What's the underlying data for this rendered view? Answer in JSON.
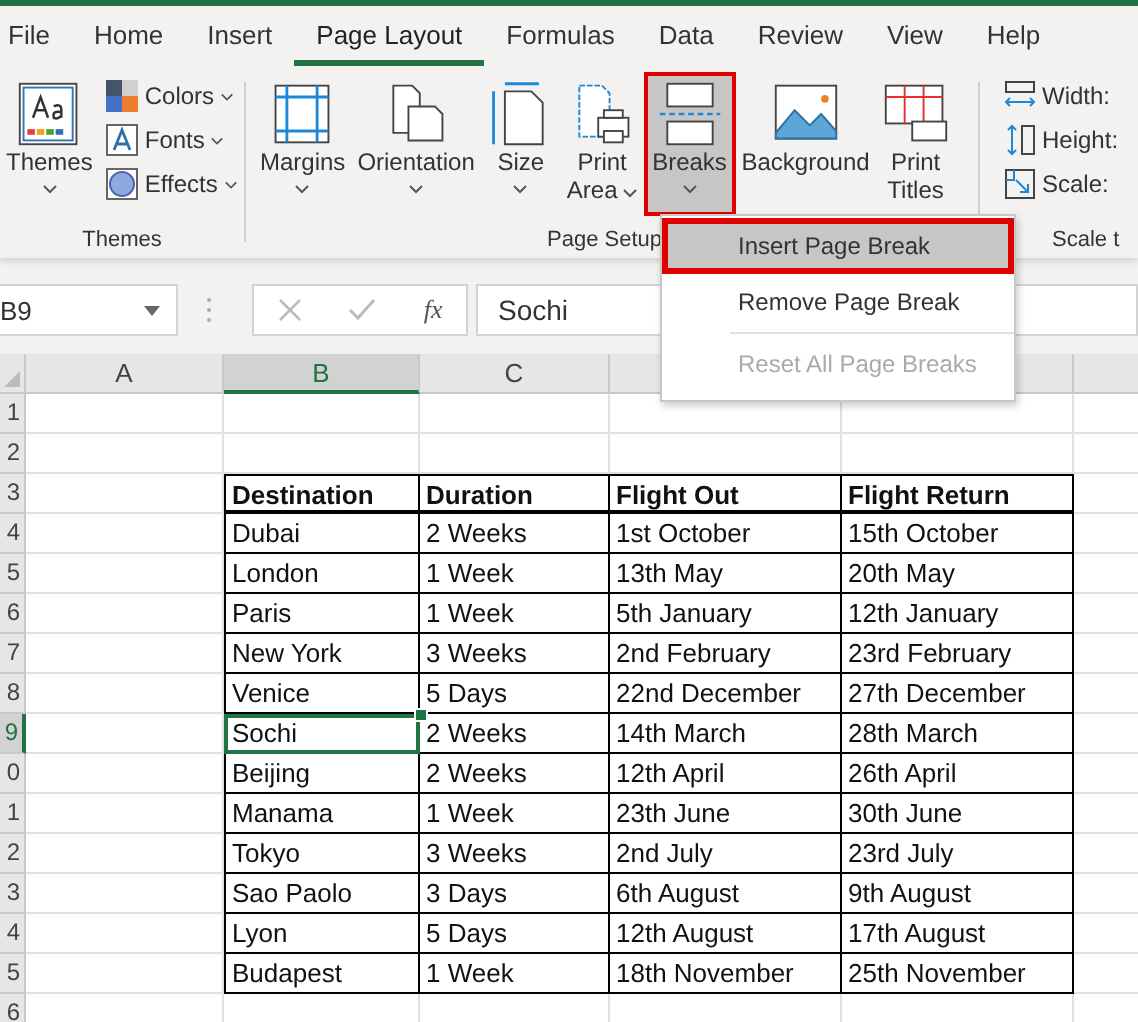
{
  "tabs": [
    {
      "label": "File",
      "selected": false
    },
    {
      "label": "Home",
      "selected": false
    },
    {
      "label": "Insert",
      "selected": false
    },
    {
      "label": "Page Layout",
      "selected": true
    },
    {
      "label": "Formulas",
      "selected": false
    },
    {
      "label": "Data",
      "selected": false
    },
    {
      "label": "Review",
      "selected": false
    },
    {
      "label": "View",
      "selected": false
    },
    {
      "label": "Help",
      "selected": false
    }
  ],
  "ribbon": {
    "groups": [
      {
        "label": "Themes",
        "buttons": [
          {
            "kind": "themes",
            "label": "Themes",
            "caret": true,
            "highlighted": false
          }
        ],
        "small_buttons": [
          {
            "kind": "colors",
            "label": "Colors"
          },
          {
            "kind": "fonts",
            "label": "Fonts"
          },
          {
            "kind": "effects",
            "label": "Effects"
          }
        ]
      },
      {
        "label": "Page Setup",
        "buttons": [
          {
            "kind": "margins",
            "label": "Margins",
            "caret": true,
            "highlighted": false
          },
          {
            "kind": "orientation",
            "label": "Orientation",
            "caret": true,
            "highlighted": false
          },
          {
            "kind": "size",
            "label": "Size",
            "caret": true,
            "highlighted": false
          },
          {
            "kind": "print-area",
            "label": "Print",
            "label_2": "Area",
            "caret": true,
            "highlighted": false
          },
          {
            "kind": "breaks",
            "label": "Breaks",
            "caret": true,
            "highlighted": true
          },
          {
            "kind": "background",
            "label": "Background",
            "caret": false,
            "highlighted": false
          },
          {
            "kind": "print-titles",
            "label": "Print",
            "label_2": "Titles",
            "caret": false,
            "highlighted": false
          }
        ]
      },
      {
        "label": "Scale t",
        "small_buttons": [
          {
            "kind": "width",
            "label": "Width:"
          },
          {
            "kind": "height",
            "label": "Height:"
          },
          {
            "kind": "scale",
            "label": "Scale:"
          }
        ]
      }
    ]
  },
  "formula_bar": {
    "name_box": "B9",
    "function_label": "fx",
    "value": "Sochi"
  },
  "dropdown": {
    "items": [
      {
        "label": "Insert Page Break",
        "selected": true,
        "disabled": false
      },
      {
        "label": "Remove Page Break",
        "selected": false,
        "disabled": false
      },
      {
        "label": "Reset All Page Breaks",
        "selected": false,
        "disabled": true
      }
    ]
  },
  "sheet": {
    "column_headers": [
      {
        "label": "A",
        "selected": false
      },
      {
        "label": "B",
        "selected": true
      },
      {
        "label": "C",
        "selected": false
      }
    ],
    "row_headers": [
      {
        "label": "1",
        "selected": false
      },
      {
        "label": "2",
        "selected": false
      },
      {
        "label": "3",
        "selected": false
      },
      {
        "label": "4",
        "selected": false
      },
      {
        "label": "5",
        "selected": false
      },
      {
        "label": "6",
        "selected": false
      },
      {
        "label": "7",
        "selected": false
      },
      {
        "label": "8",
        "selected": false
      },
      {
        "label": "9",
        "selected": true
      },
      {
        "label": "0",
        "selected": false
      },
      {
        "label": "1",
        "selected": false
      },
      {
        "label": "2",
        "selected": false
      },
      {
        "label": "3",
        "selected": false
      },
      {
        "label": "4",
        "selected": false
      },
      {
        "label": "5",
        "selected": false
      },
      {
        "label": "6",
        "selected": false
      }
    ],
    "table": {
      "columns": [
        "Destination",
        "Duration",
        "Flight Out",
        "Flight Return"
      ],
      "rows": [
        {
          "cells": [
            "Dubai",
            "2 Weeks",
            "1st October",
            "15th October"
          ],
          "active": false
        },
        {
          "cells": [
            "London",
            "1 Week",
            "13th May",
            "20th May"
          ],
          "active": false
        },
        {
          "cells": [
            "Paris",
            "1 Week",
            "5th January",
            "12th January"
          ],
          "active": false
        },
        {
          "cells": [
            "New York",
            "3 Weeks",
            "2nd February",
            "23rd February"
          ],
          "active": false
        },
        {
          "cells": [
            "Venice",
            "5 Days",
            "22nd December",
            "27th December"
          ],
          "active": false
        },
        {
          "cells": [
            "Sochi",
            "2 Weeks",
            "14th March",
            "28th March"
          ],
          "active": true
        },
        {
          "cells": [
            "Beijing",
            "2 Weeks",
            "12th April",
            "26th April"
          ],
          "active": false
        },
        {
          "cells": [
            "Manama",
            "1 Week",
            "23th June",
            "30th June"
          ],
          "active": false
        },
        {
          "cells": [
            "Tokyo",
            "3 Weeks",
            "2nd July",
            "23rd July"
          ],
          "active": false
        },
        {
          "cells": [
            "Sao Paolo",
            "3 Days",
            "6th August",
            "9th August"
          ],
          "active": false
        },
        {
          "cells": [
            "Lyon",
            "5 Days",
            "12th August",
            "17th August"
          ],
          "active": false
        },
        {
          "cells": [
            "Budapest",
            "1 Week",
            "18th November",
            "25th November"
          ],
          "active": false
        }
      ]
    }
  }
}
